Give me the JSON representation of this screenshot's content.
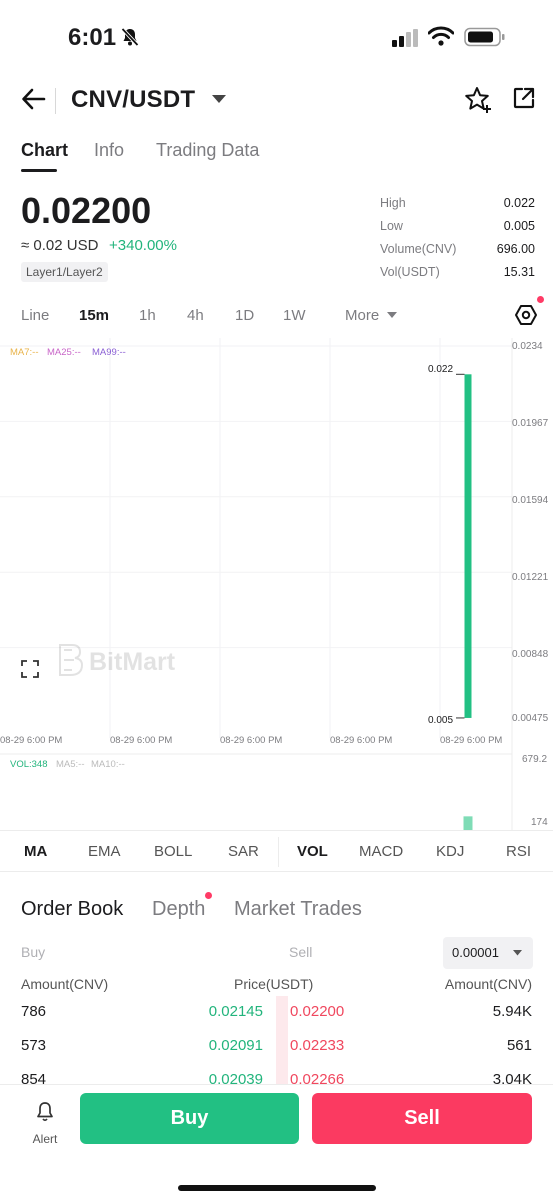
{
  "status_bar": {
    "time": "6:01"
  },
  "header": {
    "pair": "CNV/USDT"
  },
  "tabs": [
    {
      "label": "Chart",
      "active": true
    },
    {
      "label": "Info",
      "active": false
    },
    {
      "label": "Trading Data",
      "active": false
    }
  ],
  "price": {
    "last": "0.02200",
    "approx": "≈ 0.02 USD",
    "change": "+340.00%",
    "tag": "Layer1/Layer2"
  },
  "stats": [
    {
      "label": "High",
      "value": "0.022"
    },
    {
      "label": "Low",
      "value": "0.005"
    },
    {
      "label": "Volume(CNV)",
      "value": "696.00"
    },
    {
      "label": "Vol(USDT)",
      "value": "15.31"
    }
  ],
  "intervals": [
    {
      "label": "Line",
      "active": false
    },
    {
      "label": "15m",
      "active": true
    },
    {
      "label": "1h",
      "active": false
    },
    {
      "label": "4h",
      "active": false
    },
    {
      "label": "1D",
      "active": false
    },
    {
      "label": "1W",
      "active": false
    },
    {
      "label": "More",
      "active": false
    }
  ],
  "chart": {
    "ma_legend": [
      "MA7:--",
      "MA25:--",
      "MA99:--"
    ],
    "y_ticks": [
      "0.0234",
      "0.01967",
      "0.01594",
      "0.01221",
      "0.00848",
      "0.00475"
    ],
    "x_ticks": [
      "08-29 6:00 PM",
      "08-29 6:00 PM",
      "08-29 6:00 PM",
      "08-29 6:00 PM",
      "08-29 6:00 PM"
    ],
    "high_marker": "0.022",
    "low_marker": "0.005",
    "watermark": "BitMart",
    "vol_legend": [
      "VOL:348",
      "MA5:--",
      "MA10:--"
    ],
    "vol_ticks": [
      "679.2",
      "174"
    ],
    "colors": {
      "up": "#22c083",
      "ma7": "#e8b34a",
      "ma25": "#c865c8",
      "ma99": "#8a5fd4"
    }
  },
  "chart_data": {
    "type": "candlestick",
    "xlabel": "",
    "ylabel": "",
    "ylim": [
      0.00475,
      0.0234
    ],
    "candles": [
      {
        "open": 0.005,
        "high": 0.022,
        "low": 0.005,
        "close": 0.022
      }
    ],
    "volume": {
      "values": [
        348
      ],
      "ylim": [
        0,
        679.2
      ]
    }
  },
  "indicators": [
    {
      "label": "MA",
      "active": true
    },
    {
      "label": "EMA",
      "active": false
    },
    {
      "label": "BOLL",
      "active": false
    },
    {
      "label": "SAR",
      "active": false
    },
    {
      "label": "VOL",
      "active": true
    },
    {
      "label": "MACD",
      "active": false
    },
    {
      "label": "KDJ",
      "active": false
    },
    {
      "label": "RSI",
      "active": false
    }
  ],
  "order_book": {
    "tabs": [
      {
        "label": "Order Book",
        "active": true
      },
      {
        "label": "Depth",
        "active": false
      },
      {
        "label": "Market Trades",
        "active": false
      }
    ],
    "buy_label": "Buy",
    "sell_label": "Sell",
    "precision": "0.00001",
    "headers": {
      "buy_amount": "Amount(CNV)",
      "price": "Price(USDT)",
      "sell_amount": "Amount(CNV)"
    },
    "rows": [
      {
        "buy_amount": "786",
        "buy_price": "0.02145",
        "sell_price": "0.02200",
        "sell_amount": "5.94K"
      },
      {
        "buy_amount": "573",
        "buy_price": "0.02091",
        "sell_price": "0.02233",
        "sell_amount": "561"
      },
      {
        "buy_amount": "854",
        "buy_price": "0.02039",
        "sell_price": "0.02266",
        "sell_amount": "3.04K"
      }
    ]
  },
  "bottom_bar": {
    "alert": "Alert",
    "buy": "Buy",
    "sell": "Sell"
  }
}
